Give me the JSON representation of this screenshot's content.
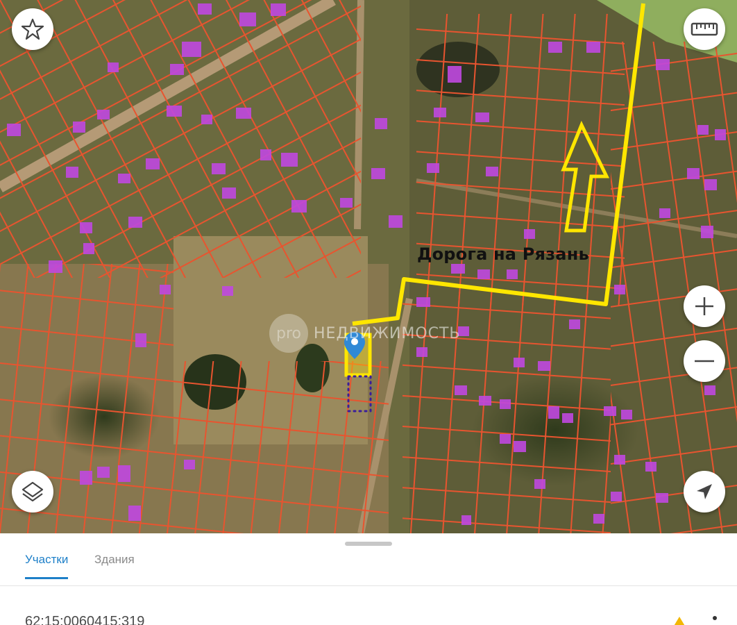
{
  "map": {
    "road_label": "Дорога на Рязань",
    "watermark_logo": "pro",
    "watermark_text": "НЕДВИЖИМОСТЬ",
    "route_color": "#ffe600",
    "boundary_color": "#e8542f",
    "building_color": "#c048e0",
    "selected_plot_color": "#ffe600"
  },
  "controls": {
    "favorite": "star-icon",
    "ruler": "ruler-icon",
    "zoom_in": "plus-icon",
    "zoom_out": "minus-icon",
    "layers": "layers-icon",
    "locate": "navigation-arrow-icon"
  },
  "sheet": {
    "tabs": [
      {
        "label": "Участки",
        "active": true
      },
      {
        "label": "Здания",
        "active": false
      }
    ],
    "cadastral_number": "62:15:0060415:319"
  }
}
